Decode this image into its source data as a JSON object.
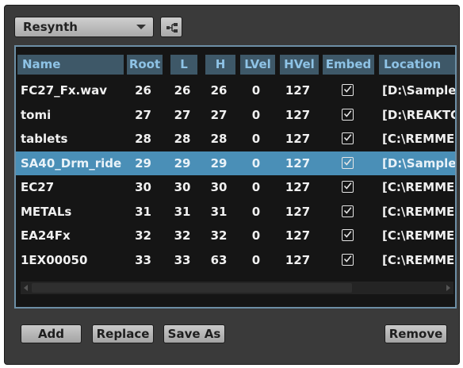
{
  "toolbar": {
    "mode_select": "Resynth",
    "tree_button_icon": "hierarchy-icon"
  },
  "table": {
    "columns": [
      "Name",
      "Root",
      "L",
      "H",
      "LVel",
      "HVel",
      "Embed",
      "Location"
    ],
    "rows": [
      {
        "name": "FC27_Fx.wav",
        "root": "26",
        "l": "26",
        "h": "26",
        "lvel": "0",
        "hvel": "127",
        "embed": true,
        "location": "[D:\\Samples"
      },
      {
        "name": "tomi",
        "root": "27",
        "l": "27",
        "h": "27",
        "lvel": "0",
        "hvel": "127",
        "embed": true,
        "location": "[D:\\REAKTO"
      },
      {
        "name": "tablets",
        "root": "28",
        "l": "28",
        "h": "28",
        "lvel": "0",
        "hvel": "127",
        "embed": true,
        "location": "[C:\\REMME"
      },
      {
        "name": "SA40_Drm_ride",
        "root": "29",
        "l": "29",
        "h": "29",
        "lvel": "0",
        "hvel": "127",
        "embed": true,
        "location": "[D:\\Samples"
      },
      {
        "name": "EC27",
        "root": "30",
        "l": "30",
        "h": "30",
        "lvel": "0",
        "hvel": "127",
        "embed": true,
        "location": "[C:\\REMME"
      },
      {
        "name": "METALs",
        "root": "31",
        "l": "31",
        "h": "31",
        "lvel": "0",
        "hvel": "127",
        "embed": true,
        "location": "[C:\\REMME"
      },
      {
        "name": "EA24Fx",
        "root": "32",
        "l": "32",
        "h": "32",
        "lvel": "0",
        "hvel": "127",
        "embed": true,
        "location": "[C:\\REMME"
      },
      {
        "name": "1EX00050",
        "root": "33",
        "l": "33",
        "h": "63",
        "lvel": "0",
        "hvel": "127",
        "embed": true,
        "location": "[C:\\REMME"
      }
    ],
    "selected_index": 3
  },
  "buttons": {
    "add": "Add",
    "replace": "Replace",
    "save_as": "Save As",
    "remove": "Remove"
  },
  "colors": {
    "selection": "#4a8fb7",
    "header_bg": "#3e5868",
    "header_text": "#8ec3e6"
  }
}
